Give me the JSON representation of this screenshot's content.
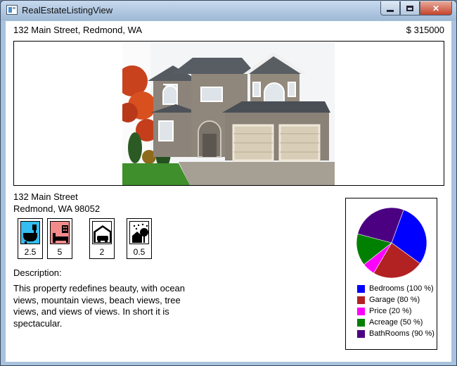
{
  "window": {
    "title": "RealEstateListingView"
  },
  "listing": {
    "header_address": "132 Main Street, Redmond, WA",
    "price": "$ 315000",
    "street": "132 Main Street",
    "city_line": "Redmond, WA 98052",
    "features": [
      {
        "icon": "bathroom-icon",
        "value": "2.5",
        "color": "#33bdf2"
      },
      {
        "icon": "bedroom-icon",
        "value": "5",
        "color": "#f48b8b"
      },
      {
        "icon": "garage-icon",
        "value": "2",
        "color": "#ffffff"
      },
      {
        "icon": "acreage-icon",
        "value": "0.5",
        "color": "#ffffff"
      }
    ],
    "description_label": "Description:",
    "description": "This property redefines beauty, with ocean views, mountain views, beach views, tree views, and views of views.  In short it is spectacular."
  },
  "chart_data": {
    "type": "pie",
    "legend": "bottom",
    "series": [
      {
        "name": "Bedrooms (100 %)",
        "value": 100,
        "color": "#0000ff"
      },
      {
        "name": "Garage (80 %)",
        "value": 80,
        "color": "#b22222"
      },
      {
        "name": "Price (20 %)",
        "value": 20,
        "color": "#ff00ff"
      },
      {
        "name": "Acreage (50 %)",
        "value": 50,
        "color": "#008000"
      },
      {
        "name": "BathRooms (90 %)",
        "value": 90,
        "color": "#4b0082"
      }
    ]
  }
}
